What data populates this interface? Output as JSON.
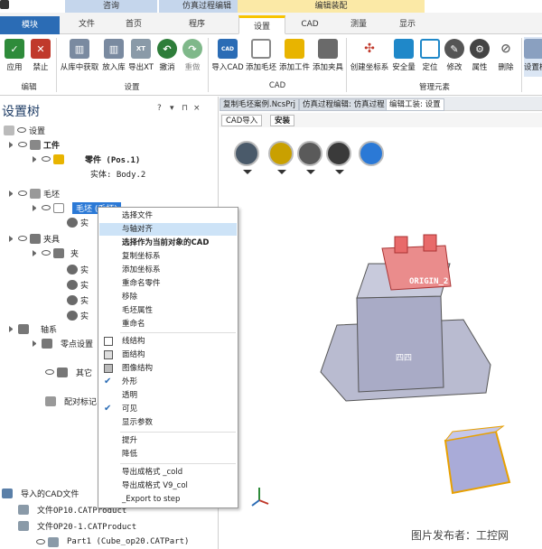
{
  "context_groups": [
    {
      "label": "咨询",
      "color": "#c5d6ec"
    },
    {
      "label": "仿真过程编辑",
      "color": "#c5d6ec"
    },
    {
      "label": "编辑装配",
      "color": "#fbe9a6"
    }
  ],
  "tabs": [
    "模块",
    "文件",
    "首页",
    "程序",
    "设置",
    "CAD",
    "测量",
    "显示"
  ],
  "active_tab": "设置",
  "ribbon": {
    "buttons": [
      {
        "label": "应用",
        "icon": "check-icon",
        "color": "#2e8b3a"
      },
      {
        "label": "禁止",
        "icon": "x-icon",
        "color": "#c0392b"
      },
      {
        "label": "从库中获取",
        "icon": "library-icon",
        "color": "#7a8aa0"
      },
      {
        "label": "放入库",
        "icon": "library-put-icon",
        "color": "#7a8aa0"
      },
      {
        "label": "导出XT",
        "icon": "export-xt-icon",
        "color": "#8a9aa8"
      },
      {
        "label": "撤消",
        "icon": "undo-icon",
        "color": "#2e7d3a"
      },
      {
        "label": "重做",
        "icon": "redo-icon",
        "color": "#7fb88a"
      },
      {
        "label": "导入CAD",
        "icon": "import-cad-icon",
        "color": "#2b6cb5"
      },
      {
        "label": "添加毛坯",
        "icon": "add-stock-icon",
        "color": "#888888"
      },
      {
        "label": "添加工件",
        "icon": "add-part-icon",
        "color": "#e8b400"
      },
      {
        "label": "添加夹具",
        "icon": "add-fixture-icon",
        "color": "#6a6a6a"
      },
      {
        "label": "创建坐标系",
        "icon": "axis-icon",
        "color": "#c0392b"
      },
      {
        "label": "安全量",
        "icon": "safety-icon",
        "color": "#1f88c9"
      },
      {
        "label": "定位",
        "icon": "locate-icon",
        "color": "#1f88c9"
      },
      {
        "label": "修改",
        "icon": "edit-icon",
        "color": "#555555"
      },
      {
        "label": "属性",
        "icon": "gear-icon",
        "color": "#444444"
      },
      {
        "label": "删除",
        "icon": "delete-icon",
        "color": "#666666"
      },
      {
        "label": "设置模式",
        "icon": "mode-icon",
        "color": "#8aa0c0"
      }
    ],
    "groups": [
      "编辑",
      "设置",
      "CAD",
      "管理元素"
    ]
  },
  "left_panel": {
    "title": "设置树",
    "controls": [
      "?",
      "▾",
      "⊓",
      "×"
    ],
    "tree": [
      "设置",
      "工件",
      "零件  (Pos.1)",
      "实体: Body.2",
      "毛坯",
      "毛坯 (毛坯)",
      "实",
      "夹具",
      "夹",
      "实",
      "实",
      "实",
      "实",
      "轴系",
      "零点设置",
      "其它",
      "配对标记"
    ],
    "cad_files": [
      "导入的CAD文件",
      "文件OP10.CATProduct",
      "文件OP20-1.CATProduct",
      "Part1  (Cube_op20.CATPart)"
    ]
  },
  "doc_tabs": [
    "复制毛坯案例.NcsPrj",
    "仿真过程编辑: 仿真过程",
    "编辑工装: 设置"
  ],
  "sub_tabs": [
    "CAD导入",
    "安装"
  ],
  "viewport": {
    "origin_label": "ORIGIN_2",
    "face_label": "四四"
  },
  "context_menu": {
    "items": [
      "选择文件",
      "与轴对齐",
      "选择作为当前对象的CAD",
      "复制坐标系",
      "添加坐标系",
      "重命名零件",
      "移除",
      "毛坯属性",
      "重命名",
      "线结构",
      "面结构",
      "图像结构",
      "外形",
      "透明",
      "可见",
      "显示参数",
      "提升",
      "降低",
      "导出成格式 _cold",
      "导出成格式 V9_col",
      "_Export to step"
    ],
    "highlighted": "与轴对齐",
    "checked": [
      "外形",
      "可见"
    ]
  },
  "watermark": "图片发布者：工控网"
}
